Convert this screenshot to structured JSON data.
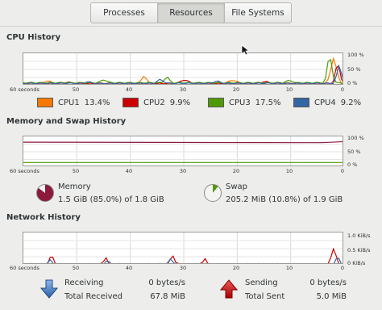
{
  "tabs": [
    "Processes",
    "Resources",
    "File Systems"
  ],
  "cpu": {
    "title": "CPU History",
    "yticks": [
      "100 %",
      "50 %",
      "0 %"
    ],
    "xticks": [
      "60 seconds",
      "50",
      "40",
      "30",
      "20",
      "10",
      "0"
    ],
    "legend": [
      {
        "name": "CPU1",
        "value": "13.4%",
        "color": "#f57900"
      },
      {
        "name": "CPU2",
        "value": "9.9%",
        "color": "#cc0000"
      },
      {
        "name": "CPU3",
        "value": "17.5%",
        "color": "#4e9a06"
      },
      {
        "name": "CPU4",
        "value": "9.2%",
        "color": "#3465a4"
      }
    ]
  },
  "memory": {
    "title": "Memory and Swap History",
    "yticks": [
      "100 %",
      "50 %",
      "0 %"
    ],
    "xticks": [
      "60 seconds",
      "50",
      "40",
      "30",
      "20",
      "10",
      "0"
    ],
    "memory_label": "Memory",
    "memory_value": "1.5 GiB (85.0%) of 1.8 GiB",
    "memory_fraction": 0.85,
    "memory_color": "#8b1a3b",
    "swap_label": "Swap",
    "swap_value": "205.2 MiB (10.8%) of 1.9 GiB",
    "swap_fraction": 0.108,
    "swap_color": "#4e9a06"
  },
  "network": {
    "title": "Network History",
    "yticks": [
      "1.0 KiB/s",
      "0.5 KiB/s",
      "0 KiB/s"
    ],
    "xticks": [
      "60 seconds",
      "50",
      "40",
      "30",
      "20",
      "10",
      "0"
    ],
    "receiving_label": "Receiving",
    "receiving_rate": "0 bytes/s",
    "total_received_label": "Total Received",
    "total_received": "67.8 MiB",
    "sending_label": "Sending",
    "sending_rate": "0 bytes/s",
    "total_sent_label": "Total Sent",
    "total_sent": "5.0 MiB",
    "receive_color": "#3465a4",
    "send_color": "#cc0000"
  }
}
